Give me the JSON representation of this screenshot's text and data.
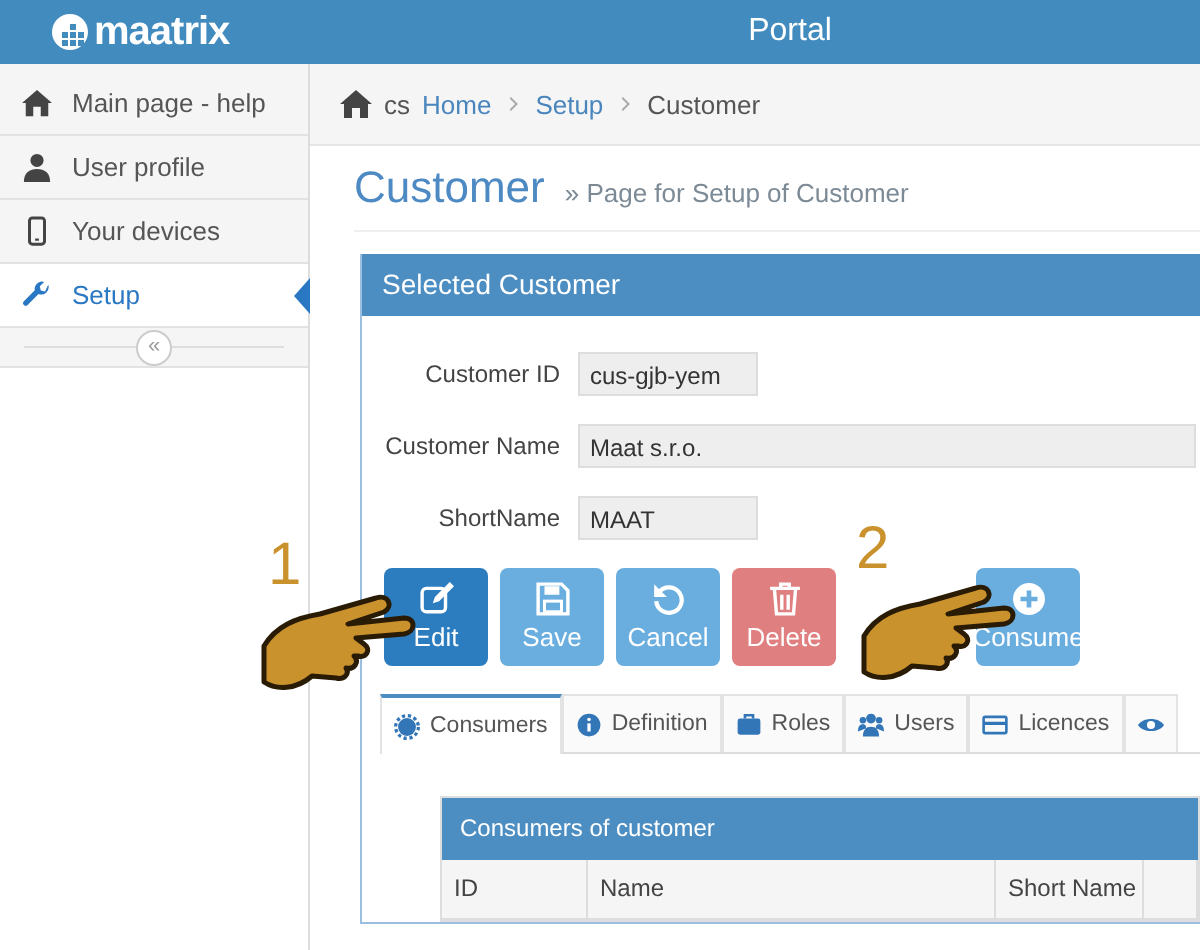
{
  "header": {
    "logo": "maatrix",
    "title": "Portal"
  },
  "sidebar": {
    "items": [
      {
        "label": "Main page - help",
        "selected": false
      },
      {
        "label": "User profile",
        "selected": false
      },
      {
        "label": "Your devices",
        "selected": false
      },
      {
        "label": "Setup",
        "selected": true
      }
    ],
    "collapse": "«"
  },
  "breadcrumb": {
    "lang": "cs",
    "items": [
      {
        "label": "Home",
        "link": true
      },
      {
        "label": "Setup",
        "link": true
      },
      {
        "label": "Customer",
        "link": false
      }
    ]
  },
  "page": {
    "title": "Customer",
    "subtitle": "» Page for Setup of Customer"
  },
  "panel": {
    "title": "Selected Customer",
    "fields": [
      {
        "label": "Customer ID",
        "value": "cus-gjb-yem"
      },
      {
        "label": "Customer Name",
        "value": "Maat s.r.o."
      },
      {
        "label": "ShortName",
        "value": "MAAT"
      }
    ],
    "buttons": [
      {
        "label": "Edit",
        "kind": "primary"
      },
      {
        "label": "Save",
        "kind": "info"
      },
      {
        "label": "Cancel",
        "kind": "info"
      },
      {
        "label": "Delete",
        "kind": "danger"
      },
      {
        "label": "Consume",
        "kind": "info"
      }
    ],
    "annotations": [
      "1",
      "2"
    ],
    "tabs": [
      {
        "label": "Consumers",
        "selected": true
      },
      {
        "label": "Definition",
        "selected": false
      },
      {
        "label": "Roles",
        "selected": false
      },
      {
        "label": "Users",
        "selected": false
      },
      {
        "label": "Licences",
        "selected": false
      },
      {
        "selected": false
      }
    ],
    "table": {
      "title": "Consumers of customer",
      "columns": [
        "ID",
        "Name",
        "Short Name"
      ]
    }
  }
}
